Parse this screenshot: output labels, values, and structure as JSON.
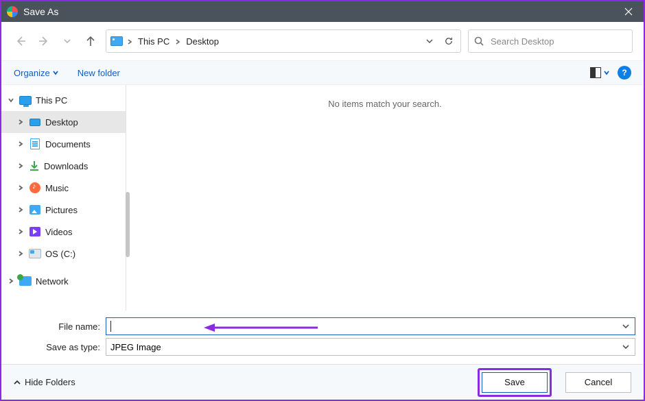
{
  "window": {
    "title": "Save As"
  },
  "breadcrumb": {
    "root_icon": "monitor-icon",
    "segments": [
      "This PC",
      "Desktop"
    ]
  },
  "search": {
    "placeholder": "Search Desktop"
  },
  "toolbar": {
    "organize": "Organize",
    "new_folder": "New folder",
    "help_glyph": "?"
  },
  "tree": {
    "this_pc": "This PC",
    "items": [
      {
        "label": "Desktop",
        "icon": "monitor-small",
        "selected": true
      },
      {
        "label": "Documents",
        "icon": "doc"
      },
      {
        "label": "Downloads",
        "icon": "download"
      },
      {
        "label": "Music",
        "icon": "music"
      },
      {
        "label": "Pictures",
        "icon": "pictures"
      },
      {
        "label": "Videos",
        "icon": "videos"
      },
      {
        "label": "OS (C:)",
        "icon": "drive"
      }
    ],
    "network": "Network"
  },
  "content": {
    "empty_message": "No items match your search."
  },
  "form": {
    "filename_label": "File name:",
    "filename_value": "",
    "savetype_label": "Save as type:",
    "savetype_value": "JPEG Image"
  },
  "footer": {
    "hide_folders": "Hide Folders",
    "save": "Save",
    "cancel": "Cancel"
  },
  "annotations": {
    "save_highlight_color": "#8a2be2",
    "arrow_color": "#8a2be2"
  }
}
